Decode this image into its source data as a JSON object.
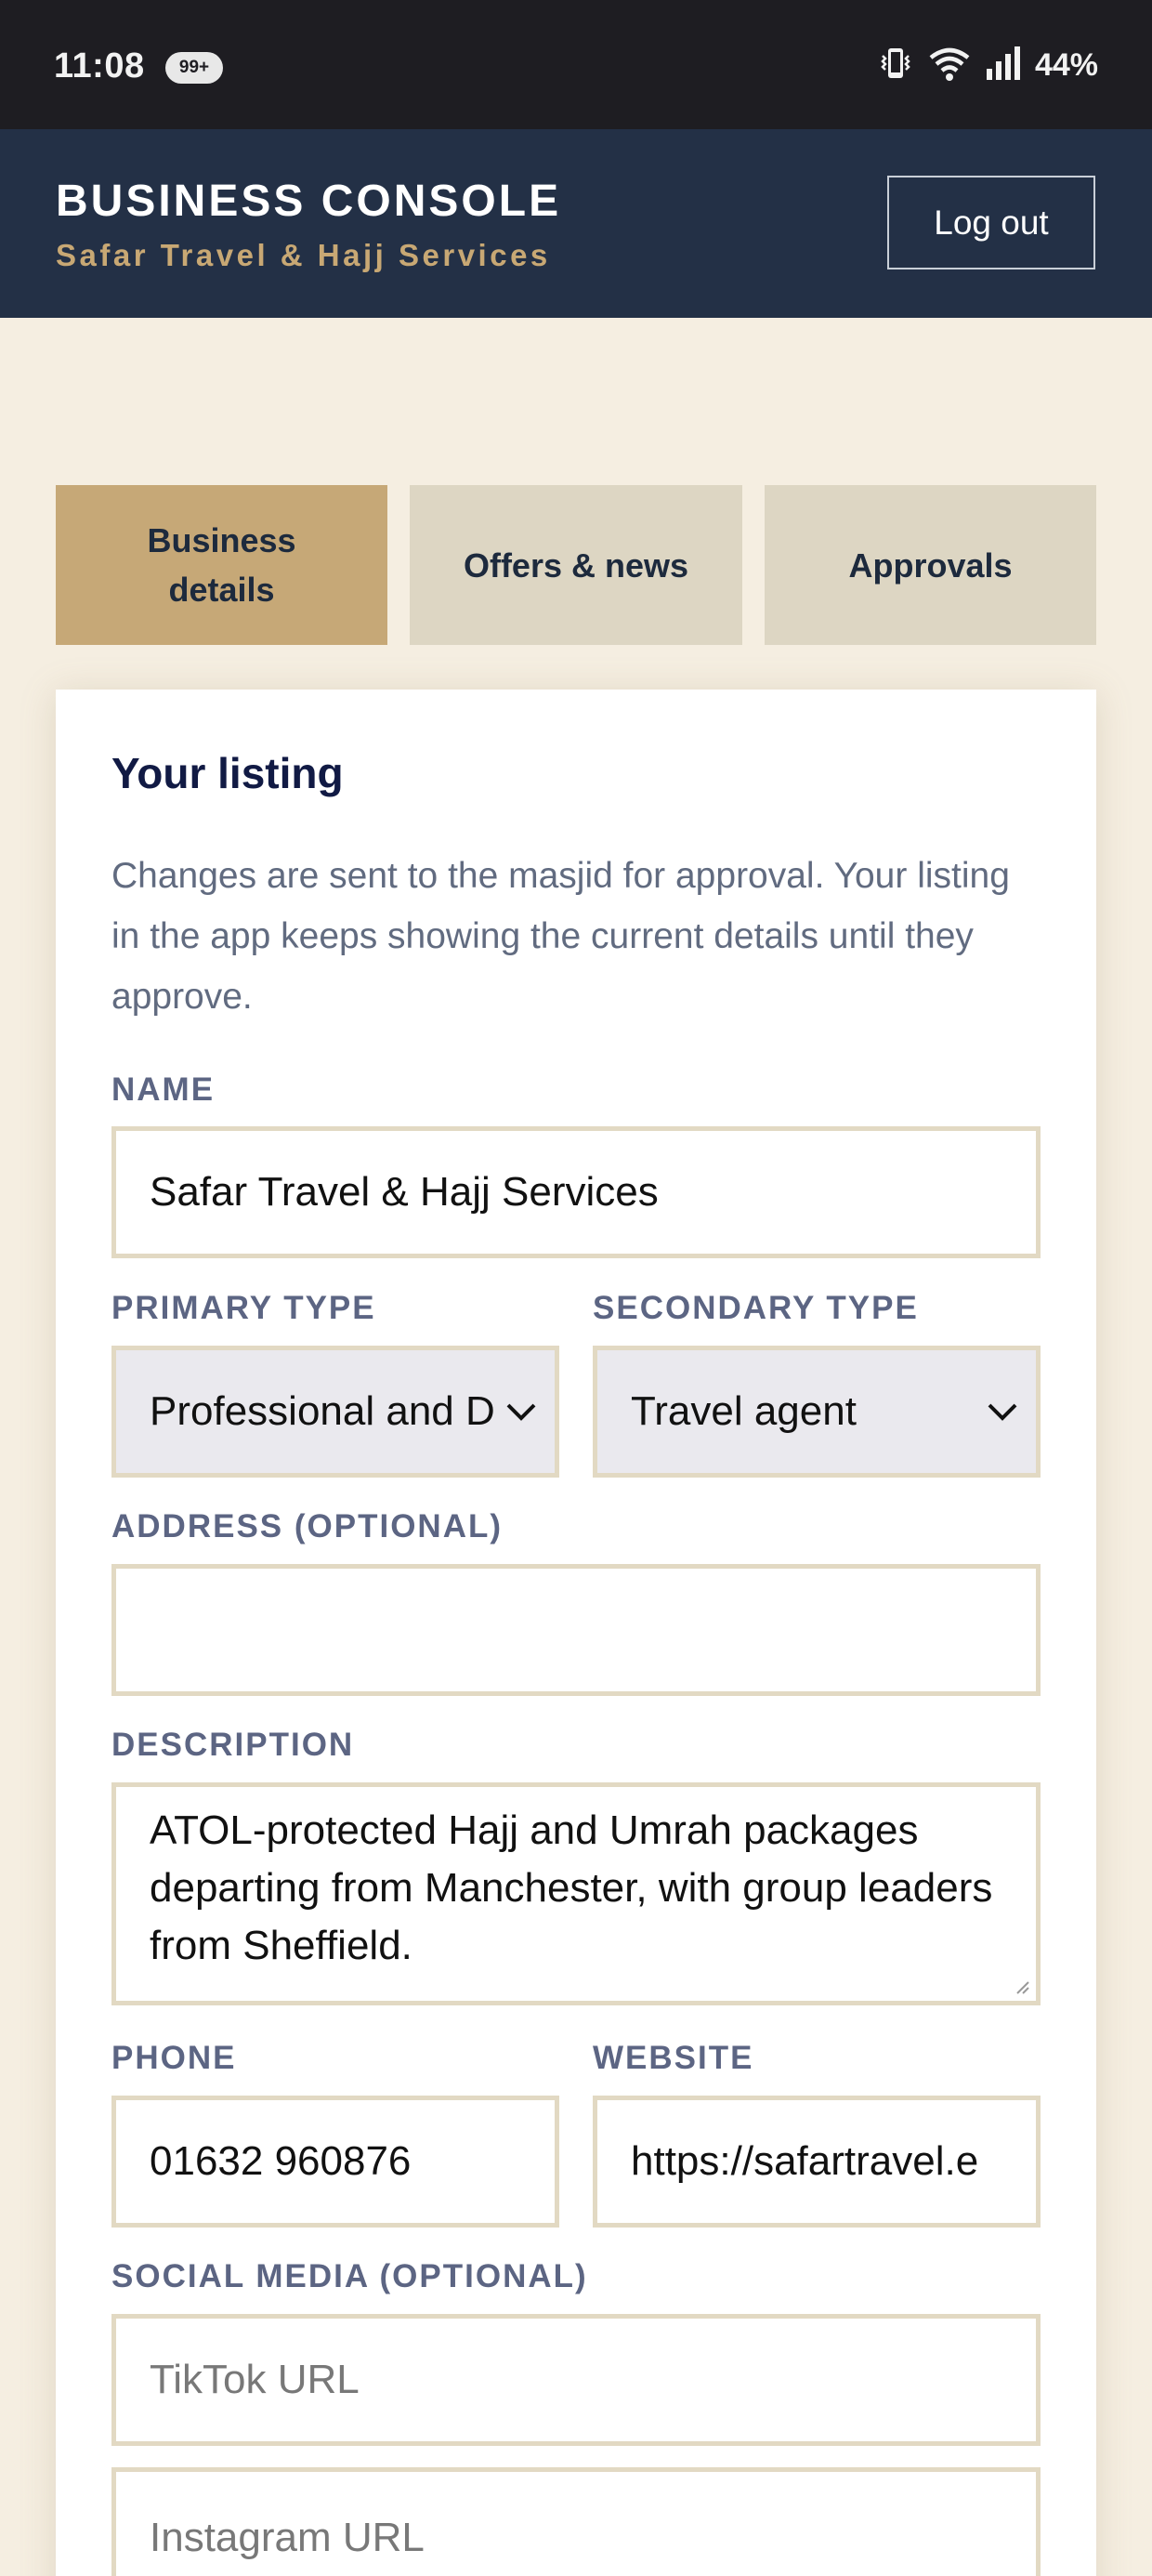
{
  "status_bar": {
    "time": "11:08",
    "notification_badge": "99+",
    "battery": "44%",
    "icons": [
      "vibrate-icon",
      "wifi-icon",
      "signal-icon"
    ]
  },
  "header": {
    "title": "BUSINESS CONSOLE",
    "subtitle": "Safar Travel & Hajj Services",
    "logout_label": "Log out"
  },
  "tabs": [
    {
      "label": "Business details",
      "active": true
    },
    {
      "label": "Offers & news",
      "active": false
    },
    {
      "label": "Approvals",
      "active": false
    }
  ],
  "listing": {
    "title": "Your listing",
    "description": "Changes are sent to the masjid for approval. Your listing in the app keeps showing the current details until they approve.",
    "name_label": "NAME",
    "name_value": "Safar Travel & Hajj Services",
    "primary_type_label": "PRIMARY TYPE",
    "primary_type_value": "Professional and D",
    "secondary_type_label": "SECONDARY TYPE",
    "secondary_type_value": "Travel agent",
    "address_label": "ADDRESS (OPTIONAL)",
    "address_value": "",
    "description_label": "DESCRIPTION",
    "description_value": "ATOL-protected Hajj and Umrah packages departing from Manchester, with group leaders from Sheffield.",
    "phone_label": "PHONE",
    "phone_value": "01632 960876",
    "website_label": "WEBSITE",
    "website_value": "https://safartravel.e",
    "social_label": "SOCIAL MEDIA (OPTIONAL)",
    "tiktok_placeholder": "TikTok URL",
    "instagram_placeholder": "Instagram URL"
  },
  "colors": {
    "header_bg": "#233046",
    "accent_gold": "#c6a877",
    "page_bg": "#f5eee1",
    "tab_inactive": "#ddd6c3",
    "field_border": "#e2d9c3"
  }
}
